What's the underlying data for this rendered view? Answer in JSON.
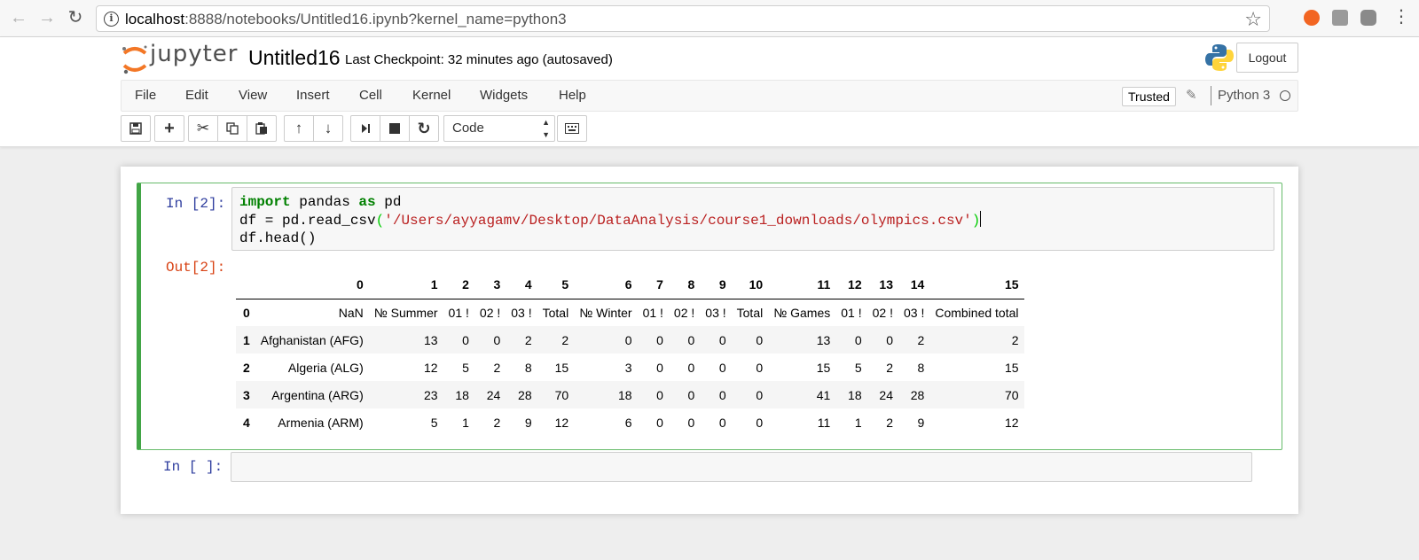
{
  "browser": {
    "url_host": "localhost",
    "url_rest": ":8888/notebooks/Untitled16.ipynb?kernel_name=python3",
    "back_icon": "arrow-left-icon",
    "forward_icon": "arrow-right-icon",
    "reload_icon": "reload-icon",
    "star_icon": "star-icon"
  },
  "header": {
    "logo_text": "jupyter",
    "notebook_title": "Untitled16",
    "checkpoint": "Last Checkpoint: 32 minutes ago (autosaved)",
    "logout_label": "Logout"
  },
  "menubar": {
    "items": [
      "File",
      "Edit",
      "View",
      "Insert",
      "Cell",
      "Kernel",
      "Widgets",
      "Help"
    ],
    "trusted_label": "Trusted",
    "kernel_name": "Python 3"
  },
  "toolbar": {
    "cell_type": "Code",
    "buttons": [
      "save-icon",
      "plus-icon",
      "scissors-icon",
      "copy-icon",
      "paste-icon",
      "arrow-up-icon",
      "arrow-down-icon",
      "step-forward-icon",
      "stop-icon",
      "restart-icon",
      "keyboard-icon"
    ]
  },
  "cell1": {
    "in_prompt": "In [2]:",
    "out_prompt": "Out[2]:",
    "code": {
      "line1_kw1": "import",
      "line1_mid": " pandas ",
      "line1_kw2": "as",
      "line1_end": " pd",
      "line2_start": "df = pd.read_csv",
      "line2_open": "(",
      "line2_str": "'/Users/ayyagamv/Desktop/DataAnalysis/course1_downloads/olympics.csv'",
      "line2_close": ")",
      "line3": "df.head()"
    },
    "table": {
      "columns": [
        "",
        "0",
        "1",
        "2",
        "3",
        "4",
        "5",
        "6",
        "7",
        "8",
        "9",
        "10",
        "11",
        "12",
        "13",
        "14",
        "15"
      ],
      "rows": [
        [
          "0",
          "NaN",
          "№ Summer",
          "01 !",
          "02 !",
          "03 !",
          "Total",
          "№ Winter",
          "01 !",
          "02 !",
          "03 !",
          "Total",
          "№ Games",
          "01 !",
          "02 !",
          "03 !",
          "Combined total"
        ],
        [
          "1",
          "Afghanistan (AFG)",
          "13",
          "0",
          "0",
          "2",
          "2",
          "0",
          "0",
          "0",
          "0",
          "0",
          "13",
          "0",
          "0",
          "2",
          "2"
        ],
        [
          "2",
          "Algeria (ALG)",
          "12",
          "5",
          "2",
          "8",
          "15",
          "3",
          "0",
          "0",
          "0",
          "0",
          "15",
          "5",
          "2",
          "8",
          "15"
        ],
        [
          "3",
          "Argentina (ARG)",
          "23",
          "18",
          "24",
          "28",
          "70",
          "18",
          "0",
          "0",
          "0",
          "0",
          "41",
          "18",
          "24",
          "28",
          "70"
        ],
        [
          "4",
          "Armenia (ARM)",
          "5",
          "1",
          "2",
          "9",
          "12",
          "6",
          "0",
          "0",
          "0",
          "0",
          "11",
          "1",
          "2",
          "9",
          "12"
        ]
      ]
    }
  },
  "cell2": {
    "in_prompt": "In [ ]:"
  }
}
